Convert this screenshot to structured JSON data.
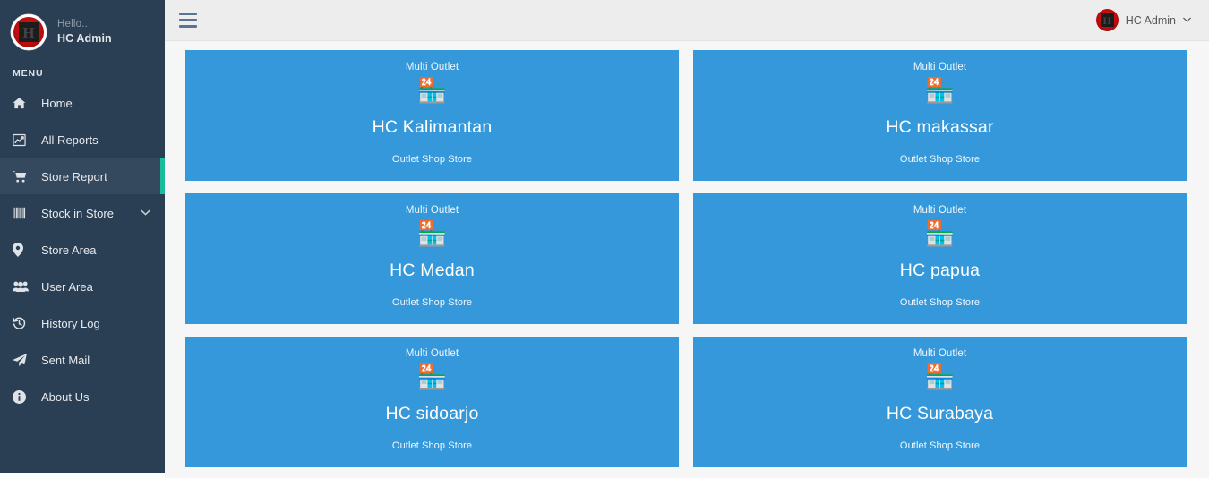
{
  "sidebar": {
    "profile": {
      "greeting": "Hello..",
      "name": "HC Admin",
      "logo_letter": "H"
    },
    "section_title": "MENU",
    "items": [
      {
        "label": "Home",
        "icon": "home-icon",
        "active": false,
        "has_chevron": false
      },
      {
        "label": "All Reports",
        "icon": "chart-line-icon",
        "active": false,
        "has_chevron": false
      },
      {
        "label": "Store Report",
        "icon": "cart-icon",
        "active": true,
        "has_chevron": false
      },
      {
        "label": "Stock in Store",
        "icon": "barcode-icon",
        "active": false,
        "has_chevron": true
      },
      {
        "label": "Store Area",
        "icon": "map-pin-icon",
        "active": false,
        "has_chevron": false
      },
      {
        "label": "User Area",
        "icon": "users-icon",
        "active": false,
        "has_chevron": false
      },
      {
        "label": "History Log",
        "icon": "history-icon",
        "active": false,
        "has_chevron": false
      },
      {
        "label": "Sent Mail",
        "icon": "paper-plane-icon",
        "active": false,
        "has_chevron": false
      },
      {
        "label": "About Us",
        "icon": "info-icon",
        "active": false,
        "has_chevron": false
      }
    ]
  },
  "topbar": {
    "menu_toggle": "hamburger-icon",
    "user": {
      "name": "HC Admin",
      "logo_letter": "H",
      "caret": "∨"
    }
  },
  "content": {
    "cards": [
      {
        "top_label": "Multi Outlet",
        "icon": "🏪",
        "title": "HC Kalimantan",
        "subtitle": "Outlet Shop Store"
      },
      {
        "top_label": "Multi Outlet",
        "icon": "🏪",
        "title": "HC makassar",
        "subtitle": "Outlet Shop Store"
      },
      {
        "top_label": "Multi Outlet",
        "icon": "🏪",
        "title": "HC Medan",
        "subtitle": "Outlet Shop Store"
      },
      {
        "top_label": "Multi Outlet",
        "icon": "🏪",
        "title": "HC papua",
        "subtitle": "Outlet Shop Store"
      },
      {
        "top_label": "Multi Outlet",
        "icon": "🏪",
        "title": "HC sidoarjo",
        "subtitle": "Outlet Shop Store"
      },
      {
        "top_label": "Multi Outlet",
        "icon": "🏪",
        "title": "HC Surabaya",
        "subtitle": "Outlet Shop Store"
      }
    ]
  },
  "colors": {
    "sidebar_bg": "#2a3f54",
    "sidebar_active_bg": "#34495e",
    "accent": "#1abc9c",
    "card_blue": "#3498db",
    "topbar_bg": "#ededed",
    "content_bg": "#f6f6f6",
    "logo_red": "#c00d0d"
  }
}
